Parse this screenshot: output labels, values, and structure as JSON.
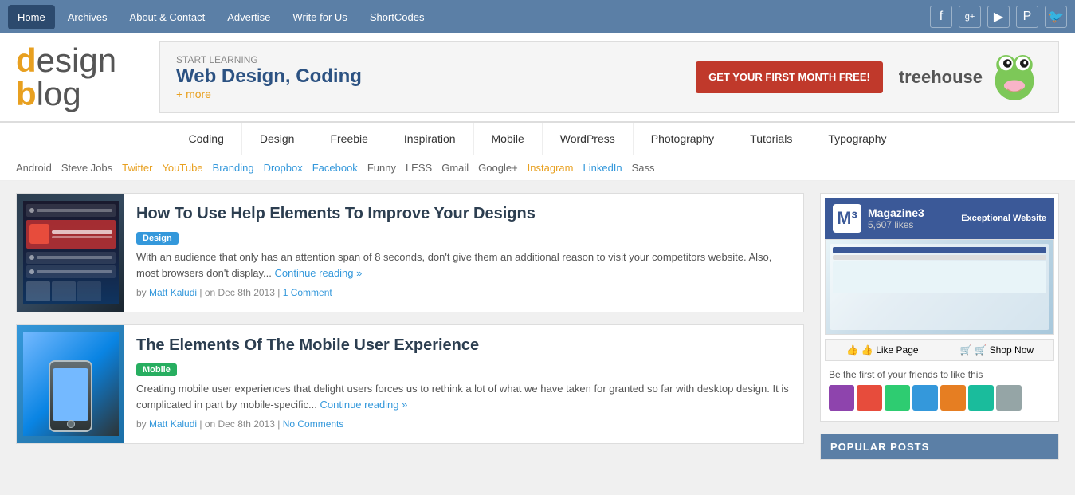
{
  "topnav": {
    "items": [
      {
        "label": "Home",
        "active": true
      },
      {
        "label": "Archives"
      },
      {
        "label": "About & Contact"
      },
      {
        "label": "Advertise"
      },
      {
        "label": "Write for Us"
      },
      {
        "label": "ShortCodes"
      }
    ],
    "social": [
      {
        "name": "facebook",
        "icon": "f"
      },
      {
        "name": "google-plus",
        "icon": "g+"
      },
      {
        "name": "youtube",
        "icon": "▶"
      },
      {
        "name": "pinterest",
        "icon": "p"
      },
      {
        "name": "twitter",
        "icon": "t"
      }
    ]
  },
  "header": {
    "logo_text1": "design",
    "logo_text2": "blog",
    "banner": {
      "start_learning": "START LEARNING",
      "main_text": "Web Design, Coding",
      "plus_more": "+ more",
      "cta_text": "GET YOUR FIRST MONTH FREE!",
      "brand": "treehouse"
    }
  },
  "categories": [
    "Coding",
    "Design",
    "Freebie",
    "Inspiration",
    "Mobile",
    "WordPress",
    "Photography",
    "Tutorials",
    "Typography"
  ],
  "tags": [
    {
      "label": "Android",
      "color": "gray"
    },
    {
      "label": "Steve Jobs",
      "color": "gray"
    },
    {
      "label": "Twitter",
      "color": "orange"
    },
    {
      "label": "YouTube",
      "color": "orange"
    },
    {
      "label": "Branding",
      "color": "blue"
    },
    {
      "label": "Dropbox",
      "color": "blue"
    },
    {
      "label": "Facebook",
      "color": "blue"
    },
    {
      "label": "Funny",
      "color": "gray"
    },
    {
      "label": "LESS",
      "color": "gray"
    },
    {
      "label": "Gmail",
      "color": "gray"
    },
    {
      "label": "Google+",
      "color": "gray"
    },
    {
      "label": "Instagram",
      "color": "orange"
    },
    {
      "label": "LinkedIn",
      "color": "blue"
    },
    {
      "label": "Sass",
      "color": "gray"
    }
  ],
  "posts": [
    {
      "title": "How To Use Help Elements To Improve Your Designs",
      "category": "Design",
      "badge_class": "badge-design",
      "excerpt": "With an audience that only has an attention span of 8 seconds, don't give them an additional reason to visit your competitors website. Also, most browsers don't display...",
      "continue": "Continue reading »",
      "author": "Matt Kaludi",
      "date": "Dec 8th 2013",
      "comments": "1 Comment",
      "thumb_type": "dark"
    },
    {
      "title": "The Elements Of The Mobile User Experience",
      "category": "Mobile",
      "badge_class": "badge-mobile",
      "excerpt": "Creating mobile user experiences that delight users forces us to rethink a lot of what we have taken for granted so far with desktop design. It is complicated in part by mobile-specific...",
      "continue": "Continue reading »",
      "author": "Matt Kaludi",
      "date": "Dec 8th 2013",
      "comments": "No Comments",
      "thumb_type": "blue"
    }
  ],
  "sidebar": {
    "fb_page_name": "Magazine3",
    "fb_likes": "5,607 likes",
    "fb_tagline": "Exceptional Website",
    "fb_friends_text": "Be the first of your friends to like this",
    "fb_like_btn": "👍 Like Page",
    "fb_shop_btn": "🛒 Shop Now",
    "popular_posts_label": "POPULAR POSTS"
  }
}
